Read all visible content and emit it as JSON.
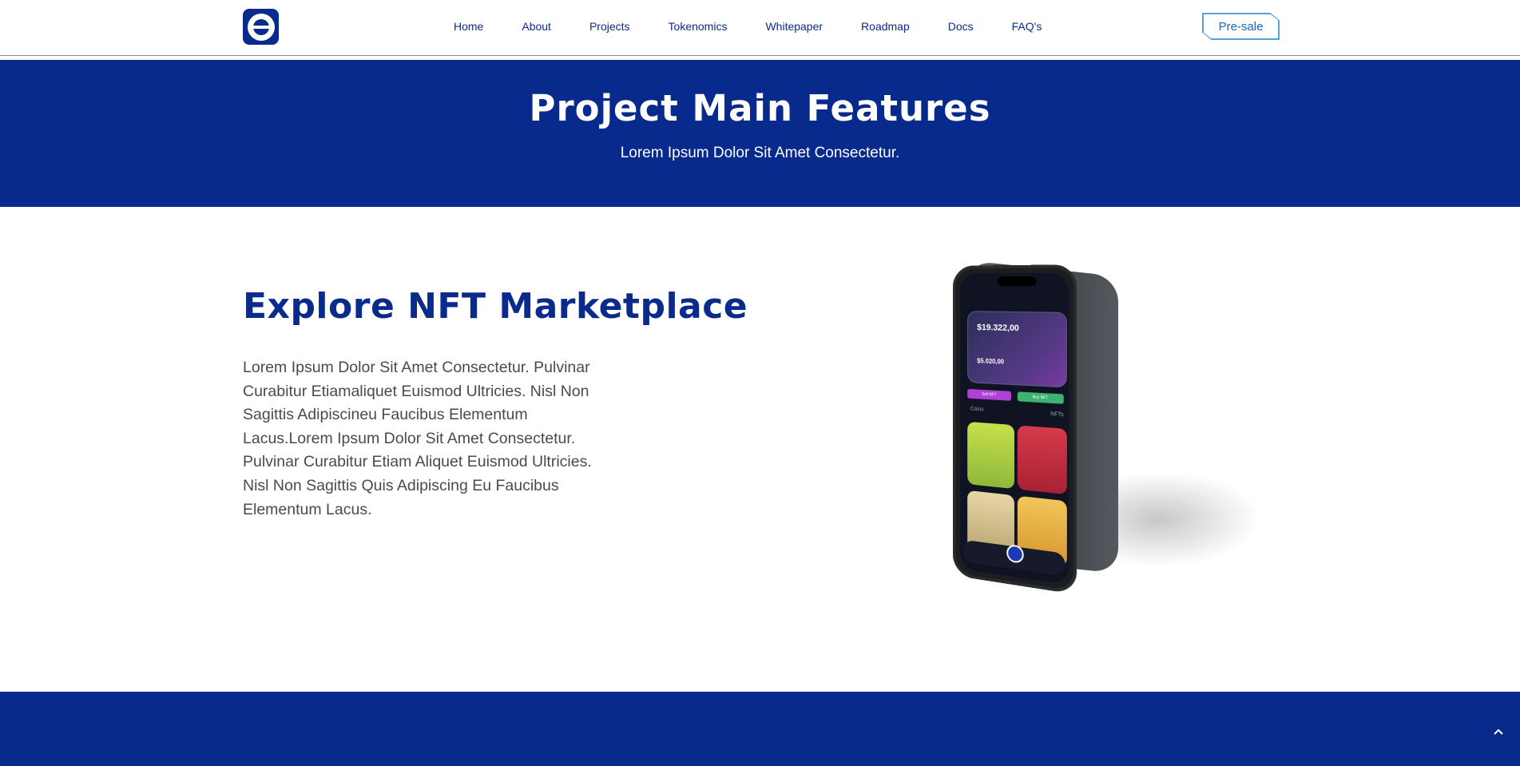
{
  "header": {
    "logo_icon": "e-logo-icon",
    "nav": [
      "Home",
      "About",
      "Projects",
      "Tokenomics",
      "Whitepaper",
      "Roadmap",
      "Docs",
      "FAQ's"
    ],
    "cta_label": "Pre-sale"
  },
  "banner": {
    "title": "Project Main Features",
    "subtitle": "Lorem Ipsum Dolor Sit Amet Consectetur."
  },
  "feature": {
    "title": "Explore NFT Marketplace",
    "text": "Lorem Ipsum Dolor Sit Amet Consectetur. Pulvinar Curabitur Etiamaliquet Euismod Ultricies. Nisl Non Sagittis Adipiscineu Faucibus Elementum Lacus.Lorem Ipsum Dolor Sit Amet Consectetur. Pulvinar Curabitur Etiam Aliquet Euismod Ultricies. Nisl Non Sagittis Quis Adipiscing Eu Faucibus Elementum Lacus.",
    "phone": {
      "balance": "$19.322,00",
      "balance2": "$5.020,00",
      "sell_label": "Sell NFT",
      "buy_label": "Buy NFT",
      "tabs": [
        "Coins",
        "NFTs"
      ]
    }
  },
  "footer": {
    "to_top_icon": "chevron-up-icon"
  },
  "colors": {
    "brand_blue": "#072a8c",
    "accent_light_blue": "#5aa0d8",
    "text_gray": "#4a4a4a"
  }
}
